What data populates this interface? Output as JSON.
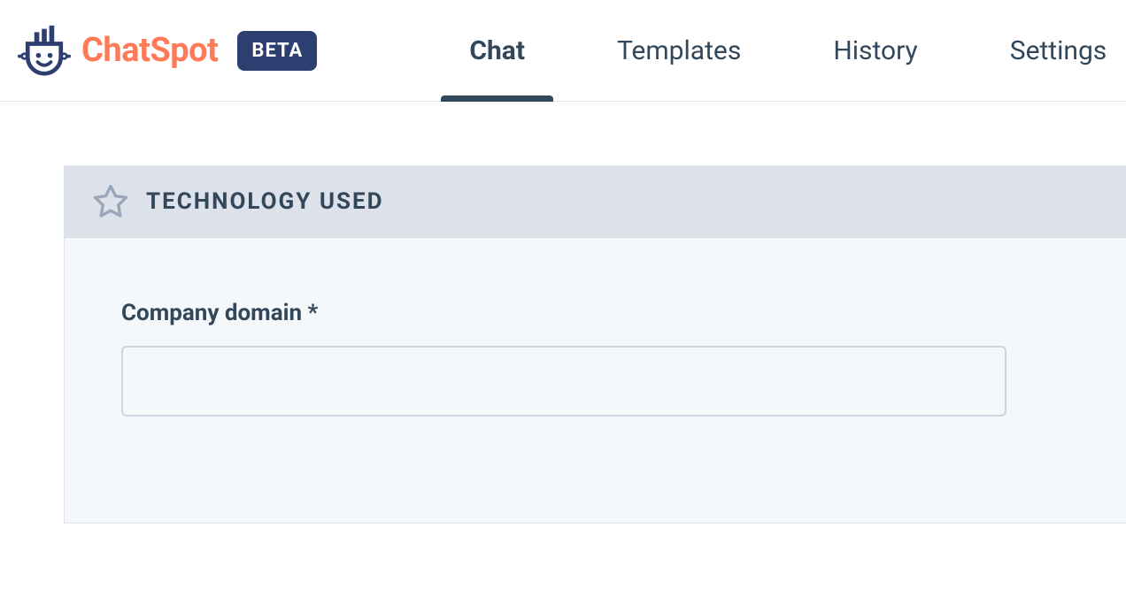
{
  "header": {
    "logo_word": "ChatSpot",
    "beta_label": "BETA",
    "nav": [
      {
        "label": "Chat",
        "active": true
      },
      {
        "label": "Templates",
        "active": false
      },
      {
        "label": "History",
        "active": false
      },
      {
        "label": "Settings",
        "active": false
      }
    ]
  },
  "card": {
    "title": "TECHNOLOGY USED",
    "field_label": "Company domain *",
    "field_value": "",
    "field_placeholder": ""
  },
  "colors": {
    "brand_orange": "#ff7a59",
    "brand_navy": "#2d3e70",
    "text": "#33475b"
  }
}
